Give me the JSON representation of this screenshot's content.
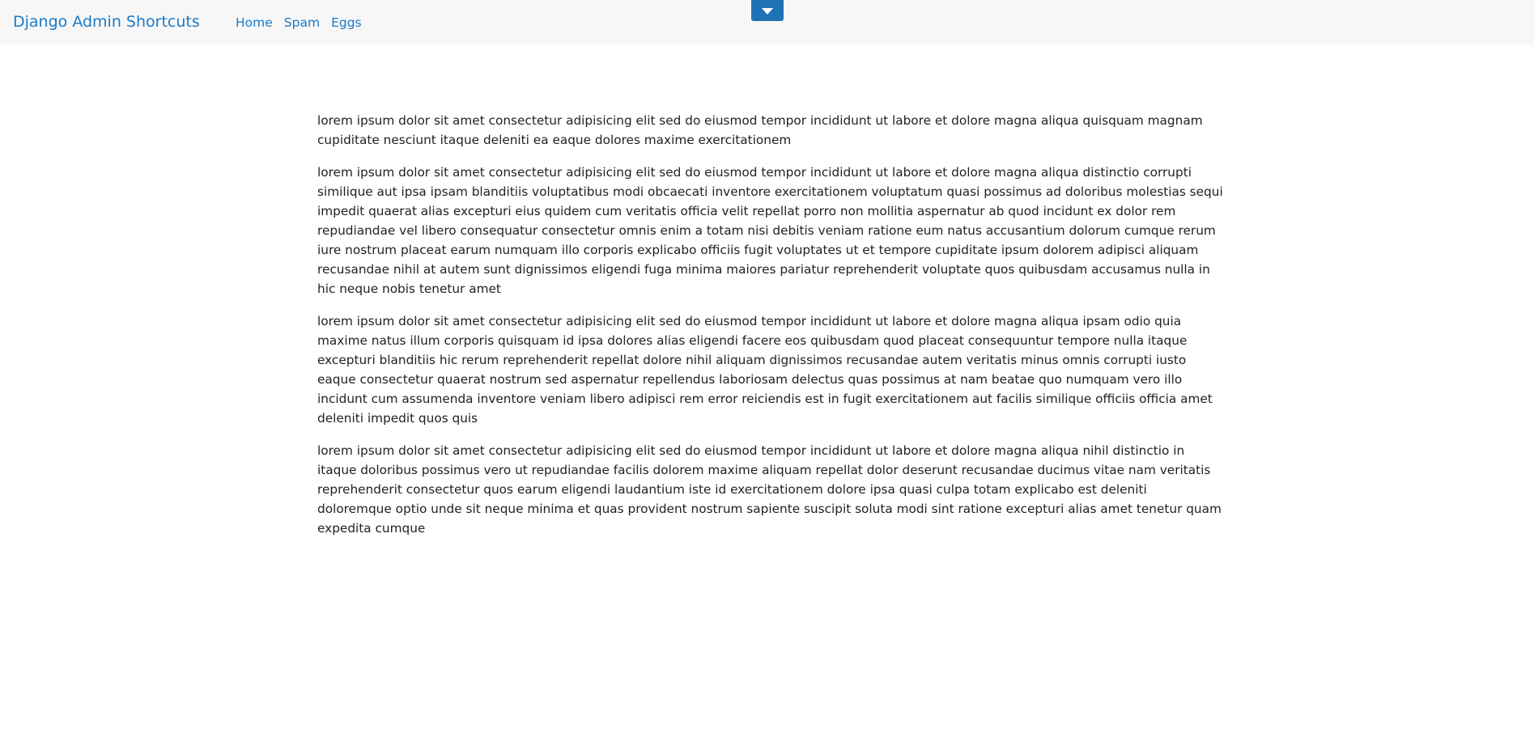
{
  "navbar": {
    "brand": "Django Admin Shortcuts",
    "links": [
      "Home",
      "Spam",
      "Eggs"
    ],
    "toggle_icon": "caret-down-icon",
    "accent_color": "#1a7ac8",
    "toggle_color": "#1f72b6"
  },
  "content": {
    "paragraphs": [
      "lorem ipsum dolor sit amet consectetur adipisicing elit sed do eiusmod tempor incididunt ut labore et dolore magna aliqua quisquam magnam cupiditate nesciunt itaque deleniti ea eaque dolores maxime exercitationem",
      "lorem ipsum dolor sit amet consectetur adipisicing elit sed do eiusmod tempor incididunt ut labore et dolore magna aliqua distinctio corrupti similique aut ipsa ipsam blanditiis voluptatibus modi obcaecati inventore exercitationem voluptatum quasi possimus ad doloribus molestias sequi impedit quaerat alias excepturi eius quidem cum veritatis officia velit repellat porro non mollitia aspernatur ab quod incidunt ex dolor rem repudiandae vel libero consequatur consectetur omnis enim a totam nisi debitis veniam ratione eum natus accusantium dolorum cumque rerum iure nostrum placeat earum numquam illo corporis explicabo officiis fugit voluptates ut et tempore cupiditate ipsum dolorem adipisci aliquam recusandae nihil at autem sunt dignissimos eligendi fuga minima maiores pariatur reprehenderit voluptate quos quibusdam accusamus nulla in hic neque nobis tenetur amet",
      "lorem ipsum dolor sit amet consectetur adipisicing elit sed do eiusmod tempor incididunt ut labore et dolore magna aliqua ipsam odio quia maxime natus illum corporis quisquam id ipsa dolores alias eligendi facere eos quibusdam quod placeat consequuntur tempore nulla itaque excepturi blanditiis hic rerum reprehenderit repellat dolore nihil aliquam dignissimos recusandae autem veritatis minus omnis corrupti iusto eaque consectetur quaerat nostrum sed aspernatur repellendus laboriosam delectus quas possimus at nam beatae quo numquam vero illo incidunt cum assumenda inventore veniam libero adipisci rem error reiciendis est in fugit exercitationem aut facilis similique officiis officia amet deleniti impedit quos quis",
      "lorem ipsum dolor sit amet consectetur adipisicing elit sed do eiusmod tempor incididunt ut labore et dolore magna aliqua nihil distinctio in itaque doloribus possimus vero ut repudiandae facilis dolorem maxime aliquam repellat dolor deserunt recusandae ducimus vitae nam veritatis reprehenderit consectetur quos earum eligendi laudantium iste id exercitationem dolore ipsa quasi culpa totam explicabo est deleniti doloremque optio unde sit neque minima et quas provident nostrum sapiente suscipit soluta modi sint ratione excepturi alias amet tenetur quam expedita cumque"
    ]
  }
}
